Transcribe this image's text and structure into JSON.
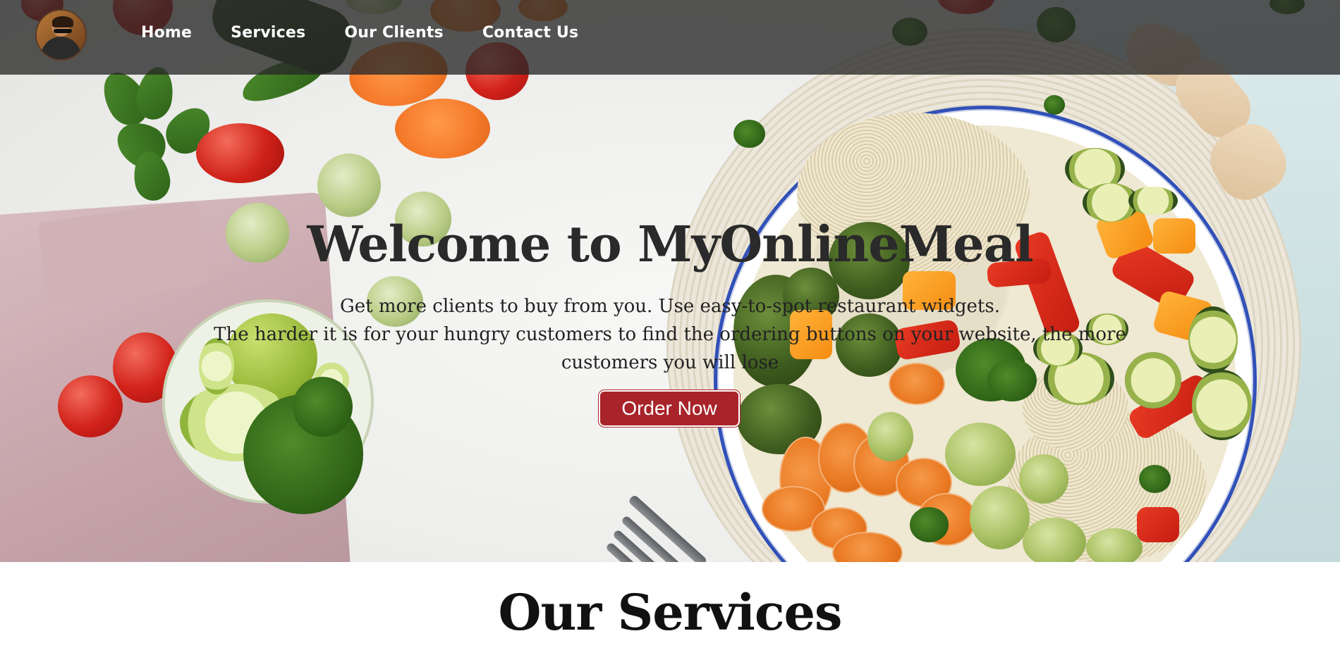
{
  "nav": {
    "avatar_alt": "profile photo",
    "links": [
      {
        "label": "Home"
      },
      {
        "label": "Services"
      },
      {
        "label": "Our Clients"
      },
      {
        "label": "Contact Us"
      }
    ]
  },
  "hero": {
    "title": "Welcome to MyOnlineMeal",
    "description_line1": "Get more clients to buy from you. Use easy-to-spot restaurant widgets.",
    "description_line2": "The harder it is for your hungry customers to find the ordering buttons on your website, the more customers you will lose",
    "order_button": "Order Now",
    "button_color": "#a8242a"
  },
  "services": {
    "heading": "Our Services"
  },
  "icons": {
    "avatar": "user-avatar"
  }
}
